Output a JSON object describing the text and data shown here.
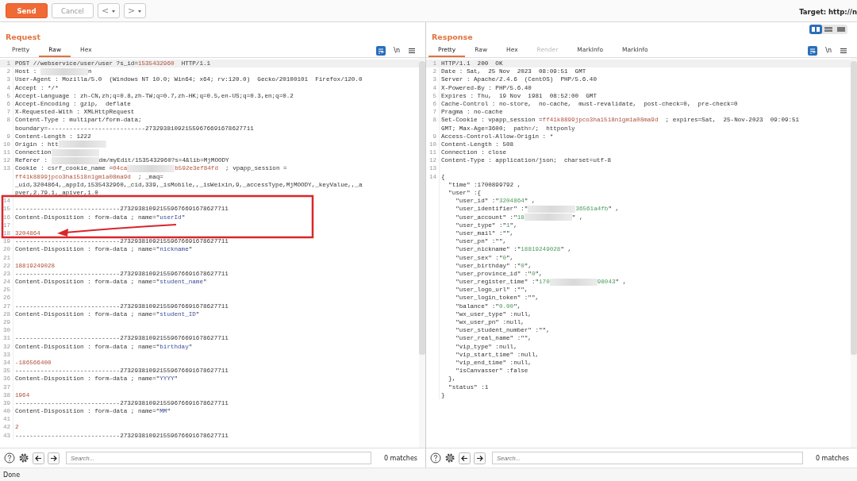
{
  "toolbar": {
    "send": "Send",
    "cancel": "Cancel",
    "back": "<",
    "forward": ">",
    "target": "Target: http://n"
  },
  "layout_toggle": [
    {
      "selected": true
    },
    {
      "selected": false
    },
    {
      "selected": false
    }
  ],
  "request": {
    "title": "Request",
    "tabs": [
      {
        "label": "Pretty",
        "selected": false,
        "disabled": false
      },
      {
        "label": "Raw",
        "selected": true,
        "disabled": false
      },
      {
        "label": "Hex",
        "selected": false,
        "disabled": false
      }
    ],
    "newline_toggle": "\\n",
    "rows": [
      {
        "number": "1",
        "segments": [
          {
            "text": "POST //webservice/user/user ?s_id=",
            "kind": "plain"
          },
          {
            "text": "1535432960",
            "kind": "value"
          },
          {
            "text": "  HTTP/1.1",
            "kind": "plain"
          }
        ]
      },
      {
        "number": "2",
        "segments": [
          {
            "text": "Host : ",
            "kind": "plain"
          },
          {
            "kind": "redacted"
          },
          {
            "text": "n",
            "kind": "plain"
          }
        ]
      },
      {
        "number": "3",
        "segments": [
          {
            "text": "User-Agent : Mozilla/5.0  (Windows NT 10.0; Win64; x64; rv:120.0)  Gecko/20100101  Firefox/120.0",
            "kind": "plain"
          }
        ]
      },
      {
        "number": "4",
        "segments": [
          {
            "text": "Accept : */*",
            "kind": "plain"
          }
        ]
      },
      {
        "number": "5",
        "segments": [
          {
            "text": "Accept-Language : zh-CN,zh;q=0.8,zh-TW;q=0.7,zh-HK;q=0.5,en-US;q=0.3,en;q=0.2",
            "kind": "plain"
          }
        ]
      },
      {
        "number": "6",
        "segments": [
          {
            "text": "Accept-Encoding : gzip,  deflate",
            "kind": "plain"
          }
        ]
      },
      {
        "number": "7",
        "segments": [
          {
            "text": "X-Requested-With : XMLHttpRequest",
            "kind": "plain"
          }
        ]
      },
      {
        "number": "8",
        "segments": [
          {
            "text": "Content-Type : multipart/form-data;",
            "kind": "plain"
          }
        ]
      },
      {
        "segments": [
          {
            "text": "boundary=---------------------------273293810921559676691678627711",
            "kind": "plain"
          }
        ]
      },
      {
        "number": "9",
        "segments": [
          {
            "text": "Content-Length : 1222",
            "kind": "plain"
          }
        ]
      },
      {
        "number": "10",
        "segments": [
          {
            "text": "Origin : htt",
            "kind": "plain"
          },
          {
            "kind": "redacted"
          }
        ]
      },
      {
        "number": "11",
        "segments": [
          {
            "text": "Connection",
            "kind": "plain"
          },
          {
            "kind": "redacted"
          }
        ]
      },
      {
        "number": "12",
        "segments": [
          {
            "text": "Referer : ",
            "kind": "plain"
          },
          {
            "kind": "redacted"
          },
          {
            "text": "dm/myEdit/1535432960?s=4&lib=MjMOODY",
            "kind": "plain"
          }
        ]
      },
      {
        "number": "13",
        "segments": [
          {
            "text": "Cookie : csrf_cookie_name =",
            "kind": "plain"
          },
          {
            "text": "04ca",
            "kind": "value"
          },
          {
            "kind": "redacted"
          },
          {
            "text": "b592e3ef84fd",
            "kind": "value"
          },
          {
            "text": "  ; vpapp_session =",
            "kind": "plain"
          }
        ]
      },
      {
        "segments": [
          {
            "text": "ff41k8899jpco3ha1518n1gm1a08ma9d",
            "kind": "value"
          },
          {
            "text": "  ; _maq=",
            "kind": "plain"
          }
        ]
      },
      {
        "segments": [
          {
            "text": "_uid,3204864,_appId,1535432960,_cid,339,_isMobile,,_isWeixin,9,_accessType,MjMOODY,_keyValue,,_a",
            "kind": "plain"
          }
        ]
      },
      {
        "segments": [
          {
            "text": "pver,2.79.1,_apiver,1.0",
            "kind": "plain"
          }
        ]
      },
      {
        "number": "14"
      },
      {
        "number": "15",
        "segments": [
          {
            "text": "-----------------------------273293810921559676691678627711",
            "kind": "plain"
          }
        ]
      },
      {
        "number": "16",
        "segments": [
          {
            "text": "Content-Disposition : form-data ; name=\"",
            "kind": "plain"
          },
          {
            "text": "userId",
            "kind": "string"
          },
          {
            "text": "\"",
            "kind": "plain"
          }
        ]
      },
      {
        "number": "17"
      },
      {
        "number": "18",
        "segments": [
          {
            "text": "3204864",
            "kind": "value"
          }
        ]
      },
      {
        "number": "19",
        "segments": [
          {
            "text": "-----------------------------273293810921559676691678627711",
            "kind": "plain"
          }
        ]
      },
      {
        "number": "20",
        "segments": [
          {
            "text": "Content-Disposition : form-data ; name=\"",
            "kind": "plain"
          },
          {
            "text": "nickname",
            "kind": "string"
          },
          {
            "text": "\"",
            "kind": "plain"
          }
        ]
      },
      {
        "number": "21"
      },
      {
        "number": "22",
        "segments": [
          {
            "text": "18819249028",
            "kind": "value"
          }
        ]
      },
      {
        "number": "23",
        "segments": [
          {
            "text": "-----------------------------273293810921559676691678627711",
            "kind": "plain"
          }
        ]
      },
      {
        "number": "24",
        "segments": [
          {
            "text": "Content-Disposition : form-data ; name=\"",
            "kind": "plain"
          },
          {
            "text": "student_name",
            "kind": "string"
          },
          {
            "text": "\"",
            "kind": "plain"
          }
        ]
      },
      {
        "number": "25"
      },
      {
        "number": "26"
      },
      {
        "number": "27",
        "segments": [
          {
            "text": "-----------------------------273293810921559676691678627711",
            "kind": "plain"
          }
        ]
      },
      {
        "number": "28",
        "segments": [
          {
            "text": "Content-Disposition : form-data ; name=\"",
            "kind": "plain"
          },
          {
            "text": "student_ID",
            "kind": "string"
          },
          {
            "text": "\"",
            "kind": "plain"
          }
        ]
      },
      {
        "number": "29"
      },
      {
        "number": "30"
      },
      {
        "number": "31",
        "segments": [
          {
            "text": "-----------------------------273293810921559676691678627711",
            "kind": "plain"
          }
        ]
      },
      {
        "number": "32",
        "segments": [
          {
            "text": "Content-Disposition : form-data ; name=\"",
            "kind": "plain"
          },
          {
            "text": "birthday",
            "kind": "string"
          },
          {
            "text": "\"",
            "kind": "plain"
          }
        ]
      },
      {
        "number": "33"
      },
      {
        "number": "34",
        "segments": [
          {
            "text": "-186566400",
            "kind": "value"
          }
        ]
      },
      {
        "number": "35",
        "segments": [
          {
            "text": "-----------------------------273293810921559676691678627711",
            "kind": "plain"
          }
        ]
      },
      {
        "number": "36",
        "segments": [
          {
            "text": "Content-Disposition : form-data ; name=\"",
            "kind": "plain"
          },
          {
            "text": "YYYY",
            "kind": "string"
          },
          {
            "text": "\"",
            "kind": "plain"
          }
        ]
      },
      {
        "number": "37"
      },
      {
        "number": "38",
        "segments": [
          {
            "text": "1964",
            "kind": "value"
          }
        ]
      },
      {
        "number": "39",
        "segments": [
          {
            "text": "-----------------------------273293810921559676691678627711",
            "kind": "plain"
          }
        ]
      },
      {
        "number": "40",
        "segments": [
          {
            "text": "Content-Disposition : form-data ; name=\"",
            "kind": "plain"
          },
          {
            "text": "MM",
            "kind": "string"
          },
          {
            "text": "\"",
            "kind": "plain"
          }
        ]
      },
      {
        "number": "41"
      },
      {
        "number": "42",
        "segments": [
          {
            "text": "2",
            "kind": "value"
          }
        ]
      },
      {
        "number": "43",
        "segments": [
          {
            "text": "-----------------------------273293810921559676691678627711",
            "kind": "plain"
          }
        ]
      }
    ],
    "search": {
      "placeholder": "Search...",
      "matches": "0 matches"
    }
  },
  "response": {
    "title": "Response",
    "tabs": [
      {
        "label": "Pretty",
        "selected": true,
        "disabled": false
      },
      {
        "label": "Raw",
        "selected": false,
        "disabled": false
      },
      {
        "label": "Hex",
        "selected": false,
        "disabled": false
      },
      {
        "label": "Render",
        "selected": false,
        "disabled": true
      },
      {
        "label": "MarkInfo",
        "selected": false,
        "disabled": false
      },
      {
        "label": "MarkInfo",
        "selected": false,
        "disabled": false
      }
    ],
    "newline_toggle": "\\n",
    "rows": [
      {
        "number": "1",
        "segments": [
          {
            "text": "HTTP/1.1  200  OK",
            "kind": "plain"
          }
        ]
      },
      {
        "number": "2",
        "segments": [
          {
            "text": "Date : Sat,  25 Nov  2023  08:09:51  GMT",
            "kind": "plain"
          }
        ]
      },
      {
        "number": "3",
        "segments": [
          {
            "text": "Server : Apache/2.4.6  (CentOS)  PHP/5.6.40",
            "kind": "plain"
          }
        ]
      },
      {
        "number": "4",
        "segments": [
          {
            "text": "X-Powered-By : PHP/5.6.40",
            "kind": "plain"
          }
        ]
      },
      {
        "number": "5",
        "segments": [
          {
            "text": "Expires : Thu,  19 Nov  1981  08:52:00  GMT",
            "kind": "plain"
          }
        ]
      },
      {
        "number": "6",
        "segments": [
          {
            "text": "Cache-Control : no-store,  no-cache,  must-revalidate,  post-check=0,  pre-check=0",
            "kind": "plain"
          }
        ]
      },
      {
        "number": "7",
        "segments": [
          {
            "text": "Pragma : no-cache",
            "kind": "plain"
          }
        ]
      },
      {
        "number": "8",
        "segments": [
          {
            "text": "Set-Cookie : vpapp_session =",
            "kind": "plain"
          },
          {
            "text": "ff41k8899jpco3ha1518n1gm1a08ma9d",
            "kind": "value"
          },
          {
            "text": "  ; expires=Sat,  25-Nov-2023  09:09:51",
            "kind": "plain"
          }
        ]
      },
      {
        "segments": [
          {
            "text": "GMT; Max-Age=3600;  path=/;  httponly",
            "kind": "plain"
          }
        ]
      },
      {
        "number": "9",
        "segments": [
          {
            "text": "Access-Control-Allow-Origin : *",
            "kind": "plain"
          }
        ]
      },
      {
        "number": "10",
        "segments": [
          {
            "text": "Content-Length : 508",
            "kind": "plain"
          }
        ]
      },
      {
        "number": "11",
        "segments": [
          {
            "text": "Connection : close",
            "kind": "plain"
          }
        ]
      },
      {
        "number": "12",
        "segments": [
          {
            "text": "Content-Type : application/json;  charset=utf-8",
            "kind": "plain"
          }
        ]
      },
      {
        "number": "13"
      },
      {
        "number": "14",
        "segments": [
          {
            "text": "{",
            "kind": "plain"
          }
        ]
      },
      {
        "segments": [
          {
            "text": "  \"time\" :1700899792 ,",
            "kind": "plain"
          }
        ]
      },
      {
        "segments": [
          {
            "text": "  \"user\" :{",
            "kind": "plain"
          }
        ]
      },
      {
        "segments": [
          {
            "text": "    \"user_id\" :\"",
            "kind": "plain"
          },
          {
            "text": "3204864",
            "kind": "green"
          },
          {
            "text": "\" ,",
            "kind": "plain"
          }
        ]
      },
      {
        "segments": [
          {
            "text": "    \"user_identifier\" :\"",
            "kind": "plain"
          },
          {
            "kind": "redacted"
          },
          {
            "text": "36561a4fb",
            "kind": "green"
          },
          {
            "text": "\" ,",
            "kind": "plain"
          }
        ]
      },
      {
        "segments": [
          {
            "text": "    \"user_account\" :\"",
            "kind": "plain"
          },
          {
            "text": "18",
            "kind": "green"
          },
          {
            "kind": "redacted"
          },
          {
            "text": "\" ,",
            "kind": "plain"
          }
        ]
      },
      {
        "segments": [
          {
            "text": "    \"user_type\" :\"",
            "kind": "plain"
          },
          {
            "text": "1",
            "kind": "green"
          },
          {
            "text": "\",",
            "kind": "plain"
          }
        ]
      },
      {
        "segments": [
          {
            "text": "    \"user_mail\" :\"\",",
            "kind": "plain"
          }
        ]
      },
      {
        "segments": [
          {
            "text": "    \"user_pn\" :\"\",",
            "kind": "plain"
          }
        ]
      },
      {
        "segments": [
          {
            "text": "    \"user_nickname\" :\"",
            "kind": "plain"
          },
          {
            "text": "18819249028",
            "kind": "green"
          },
          {
            "text": "\" ,",
            "kind": "plain"
          }
        ]
      },
      {
        "segments": [
          {
            "text": "    \"user_sex\" :\"",
            "kind": "plain"
          },
          {
            "text": "0",
            "kind": "green"
          },
          {
            "text": "\",",
            "kind": "plain"
          }
        ]
      },
      {
        "segments": [
          {
            "text": "    \"user_birthday\" :\"",
            "kind": "plain"
          },
          {
            "text": "0",
            "kind": "green"
          },
          {
            "text": "\",",
            "kind": "plain"
          }
        ]
      },
      {
        "segments": [
          {
            "text": "    \"user_province_id\" :\"",
            "kind": "plain"
          },
          {
            "text": "0",
            "kind": "green"
          },
          {
            "text": "\",",
            "kind": "plain"
          }
        ]
      },
      {
        "segments": [
          {
            "text": "    \"user_register_time\" :\"",
            "kind": "plain"
          },
          {
            "text": "170",
            "kind": "green"
          },
          {
            "kind": "redacted"
          },
          {
            "text": "98043",
            "kind": "green"
          },
          {
            "text": "\" ,",
            "kind": "plain"
          }
        ]
      },
      {
        "segments": [
          {
            "text": "    \"user_logo_url\" :\"\",",
            "kind": "plain"
          }
        ]
      },
      {
        "segments": [
          {
            "text": "    \"user_login_token\" :\"\",",
            "kind": "plain"
          }
        ]
      },
      {
        "segments": [
          {
            "text": "    \"balance\" :\"",
            "kind": "plain"
          },
          {
            "text": "0.00",
            "kind": "green"
          },
          {
            "text": "\",",
            "kind": "plain"
          }
        ]
      },
      {
        "segments": [
          {
            "text": "    \"wx_user_type\" :null,",
            "kind": "plain"
          }
        ]
      },
      {
        "segments": [
          {
            "text": "    \"wx_user_pn\" :null,",
            "kind": "plain"
          }
        ]
      },
      {
        "segments": [
          {
            "text": "    \"user_student_number\" :\"\",",
            "kind": "plain"
          }
        ]
      },
      {
        "segments": [
          {
            "text": "    \"user_real_name\" :\"\",",
            "kind": "plain"
          }
        ]
      },
      {
        "segments": [
          {
            "text": "    \"vip_type\" :null,",
            "kind": "plain"
          }
        ]
      },
      {
        "segments": [
          {
            "text": "    \"vip_start_time\" :null,",
            "kind": "plain"
          }
        ]
      },
      {
        "segments": [
          {
            "text": "    \"vip_end_time\" :null,",
            "kind": "plain"
          }
        ]
      },
      {
        "segments": [
          {
            "text": "    \"isCanvasser\" :false",
            "kind": "plain"
          }
        ]
      },
      {
        "segments": [
          {
            "text": "  },",
            "kind": "plain"
          }
        ]
      },
      {
        "segments": [
          {
            "text": "  \"status\" :1",
            "kind": "plain"
          }
        ]
      },
      {
        "segments": [
          {
            "text": "}",
            "kind": "plain"
          }
        ]
      }
    ],
    "search": {
      "placeholder": "Search...",
      "matches": "0 matches"
    }
  },
  "status_bar": "Done"
}
